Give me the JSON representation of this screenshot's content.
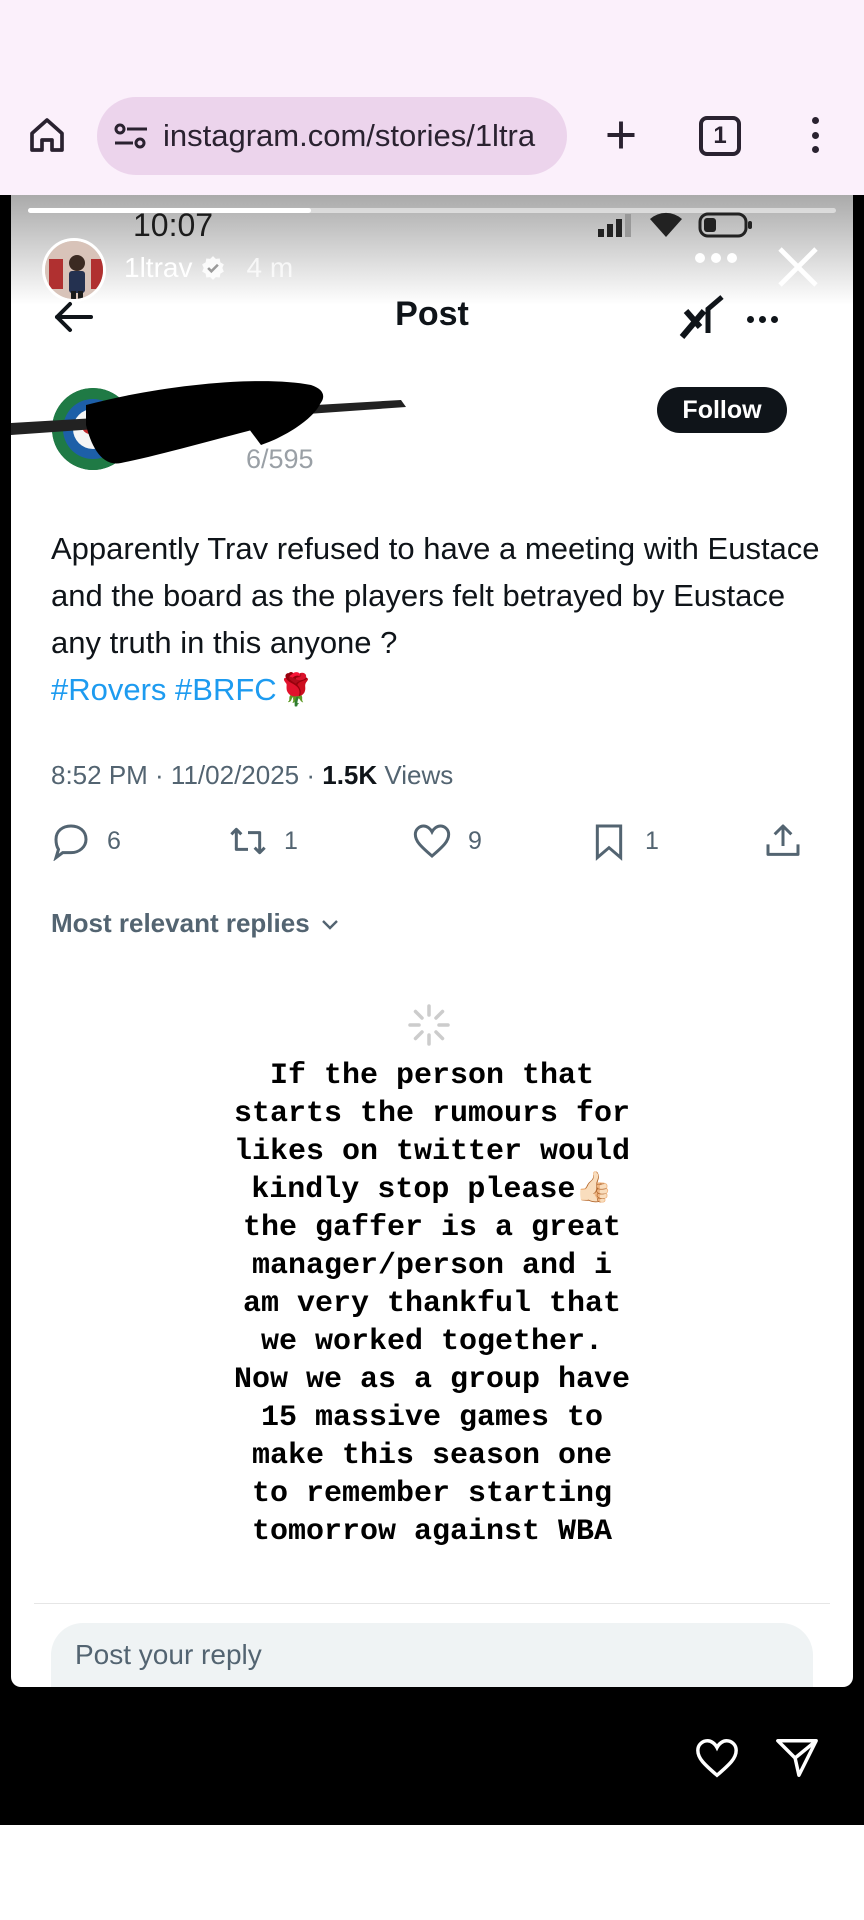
{
  "browser": {
    "url": "instagram.com/stories/1ltra",
    "tab_count": "1"
  },
  "story": {
    "phone_time": "10:07",
    "username": "1ltrav",
    "age": "4 m",
    "progress_fraction": 0.35
  },
  "post": {
    "header_title": "Post",
    "follow_label": "Follow",
    "partial_handle": "6/595",
    "body_text": "Apparently Trav refused to have a meeting with Eustace and the board as the players felt betrayed by Eustace any truth in this anyone ?",
    "hashtags": "#Rovers #BRFC",
    "emoji": "🌹",
    "time_date": "8:52 PM · 11/02/2025 · ",
    "views_count": "1.5K",
    "views_label": " Views",
    "replies": "6",
    "reposts": "1",
    "likes": "9",
    "bookmarks": "1",
    "replies_sort": "Most relevant replies",
    "reply_placeholder": "Post your reply"
  },
  "overlay_text": "If the person that\nstarts the rumours for\nlikes on twitter would\nkindly stop please👍🏻\nthe gaffer is a great\nmanager/person and i\nam very thankful that\nwe worked together.\nNow we as a group have\n15 massive games to\nmake this season one\nto remember starting\ntomorrow against WBA",
  "icons": [
    "home-icon",
    "site-settings-icon",
    "plus-icon",
    "tabs-icon",
    "more-vert-icon",
    "verified-icon",
    "close-icon",
    "back-arrow-icon",
    "grok-icon",
    "reply-icon",
    "repost-icon",
    "like-icon",
    "bookmark-icon",
    "share-icon",
    "chevron-down-icon",
    "spinner-icon",
    "heart-icon",
    "send-icon"
  ]
}
